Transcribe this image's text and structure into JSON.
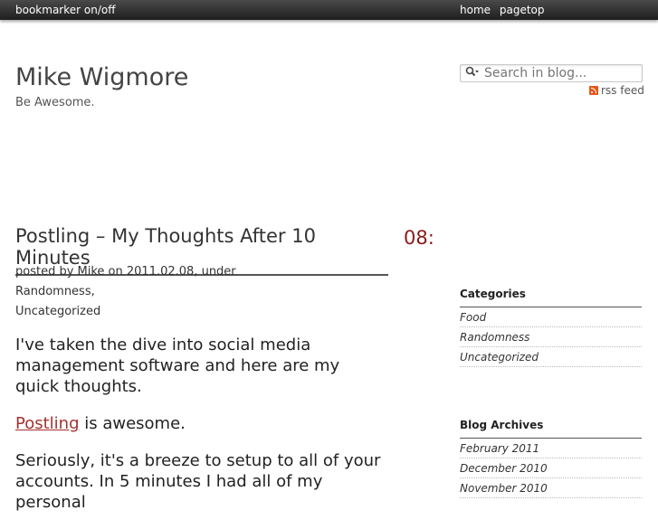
{
  "topbar": {
    "bookmarker": "bookmarker on/off",
    "links": [
      "home",
      "pagetop"
    ]
  },
  "site": {
    "title": "Mike Wigmore",
    "tagline": "Be Awesome."
  },
  "search": {
    "placeholder": "Search in blog..."
  },
  "rss": {
    "label": "rss feed"
  },
  "post": {
    "title": "Postling – My Thoughts After 10 Minutes",
    "date_fragment": "08:",
    "meta_line1": "posted by Mike on 2011.02.08, under Randomness,",
    "meta_line2": "Uncategorized",
    "para1": "I've taken the dive into social media management software and here are my quick thoughts.",
    "link_text": "Postling",
    "para2_rest": " is awesome.",
    "para3": "Seriously, it's a breeze to setup to all of your accounts. In 5 minutes I had all of my personal"
  },
  "sidebar": {
    "categories_title": "Categories",
    "categories": [
      "Food",
      "Randomness",
      "Uncategorized"
    ],
    "archives_title": "Blog Archives",
    "archives": [
      "February 2011",
      "December 2010",
      "November 2010"
    ]
  },
  "colors": {
    "accent": "#8a1a1a",
    "link": "#a43131",
    "rss": "#e7561a",
    "topbar": "#2a2a2a"
  }
}
